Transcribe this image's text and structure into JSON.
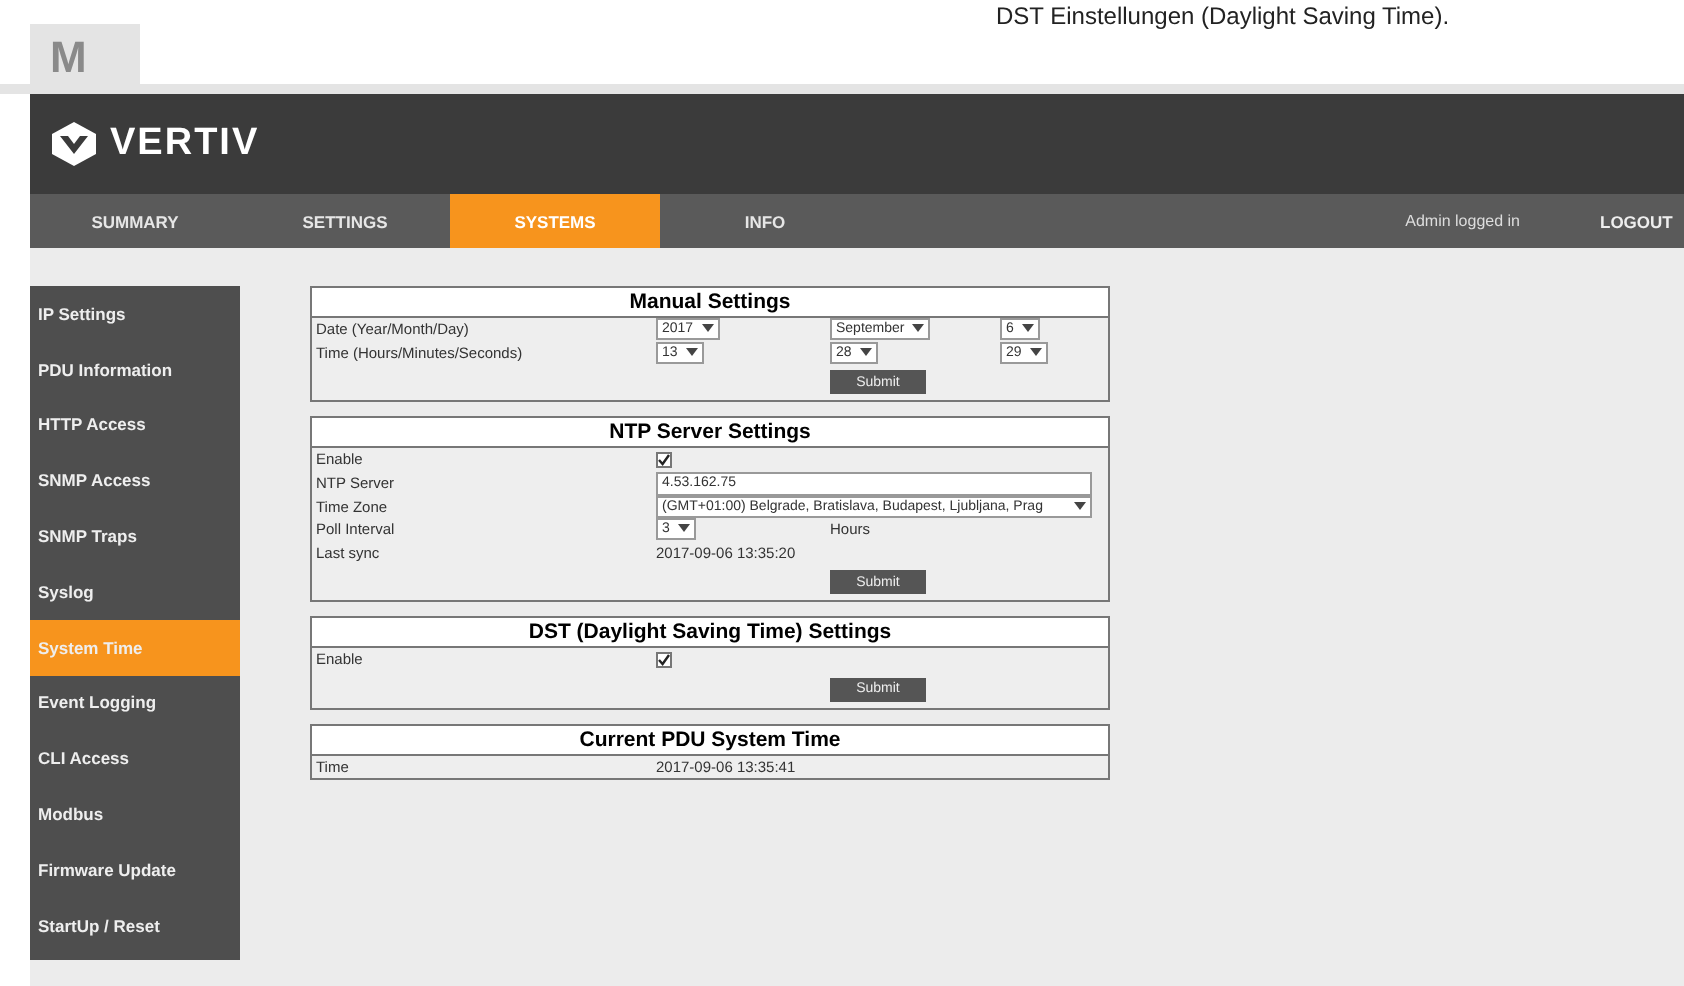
{
  "page_tab": {
    "label": "M"
  },
  "caption": "DST Einstellungen (Daylight Saving Time).",
  "header": {
    "logo_text": "VERTIV"
  },
  "nav": {
    "items": [
      {
        "label": "SUMMARY",
        "selected": false
      },
      {
        "label": "SETTINGS",
        "selected": false
      },
      {
        "label": "SYSTEMS",
        "selected": true
      },
      {
        "label": "INFO",
        "selected": false
      }
    ],
    "user_status": "Admin logged in",
    "logout": "LOGOUT"
  },
  "sidebar": {
    "items": [
      {
        "label": "IP Settings",
        "selected": false
      },
      {
        "label": "PDU Information",
        "selected": false
      },
      {
        "label": "HTTP Access",
        "selected": false
      },
      {
        "label": "SNMP Access",
        "selected": false
      },
      {
        "label": "SNMP Traps",
        "selected": false
      },
      {
        "label": "Syslog",
        "selected": false
      },
      {
        "label": "System Time",
        "selected": true
      },
      {
        "label": "Event Logging",
        "selected": false
      },
      {
        "label": "CLI Access",
        "selected": false
      },
      {
        "label": "Modbus",
        "selected": false
      },
      {
        "label": "Firmware Update",
        "selected": false
      },
      {
        "label": "StartUp / Reset",
        "selected": false
      }
    ]
  },
  "panels": [
    {
      "title": "Manual Settings",
      "submit": "Submit",
      "rows": [
        {
          "kind": "selects",
          "label": "Date (Year/Month/Day)",
          "values": [
            "2017",
            "September",
            "6"
          ]
        },
        {
          "kind": "selects",
          "label": "Time (Hours/Minutes/Seconds)",
          "values": [
            "13",
            "28",
            "29"
          ]
        }
      ]
    },
    {
      "title": "NTP Server Settings",
      "submit": "Submit",
      "rows": [
        {
          "kind": "checkbox",
          "label": "Enable",
          "checked": true
        },
        {
          "kind": "input",
          "label": "NTP Server",
          "value": "4.53.162.75"
        },
        {
          "kind": "wide_select",
          "label": "Time Zone",
          "value": "(GMT+01:00) Belgrade, Bratislava, Budapest, Ljubljana, Prag"
        },
        {
          "kind": "unit_select",
          "label": "Poll Interval",
          "value": "3",
          "unit": "Hours"
        },
        {
          "kind": "text",
          "label": "Last sync",
          "value": "2017-09-06 13:35:20"
        }
      ]
    },
    {
      "title": "DST (Daylight Saving Time) Settings",
      "submit": "Submit",
      "rows": [
        {
          "kind": "checkbox",
          "label": "Enable",
          "checked": true
        }
      ]
    },
    {
      "title": "Current PDU System Time",
      "rows": [
        {
          "kind": "text",
          "label": "Time",
          "value": "2017-09-06 13:35:41"
        }
      ]
    }
  ]
}
